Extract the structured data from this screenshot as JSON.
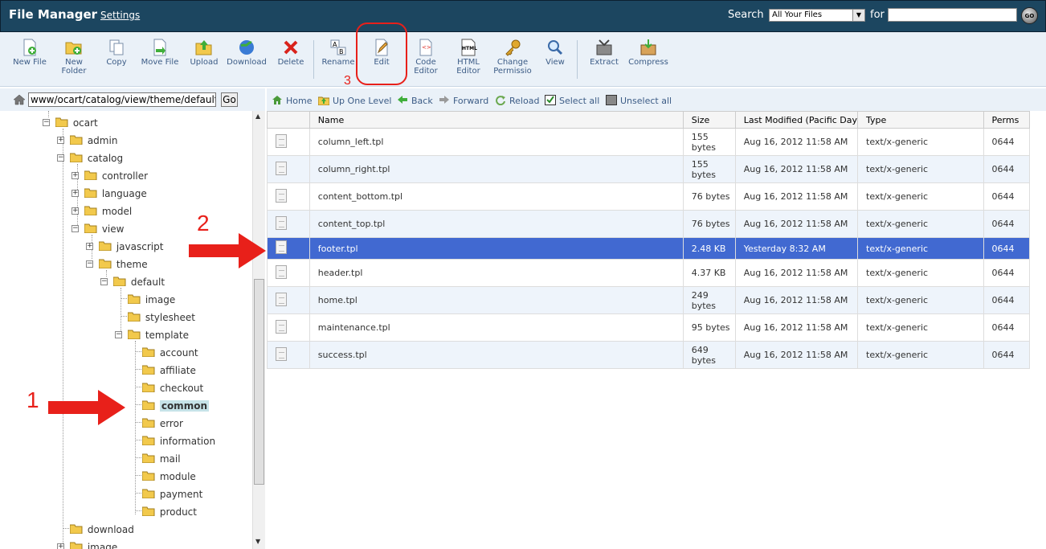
{
  "header": {
    "title": "File Manager",
    "settings_label": "Settings",
    "search_label": "Search",
    "search_scope": "All Your Files",
    "for_label": "for",
    "go_label": "GO"
  },
  "toolbar": {
    "new_file": "New File",
    "new_folder": "New Folder",
    "copy": "Copy",
    "move_file": "Move File",
    "upload": "Upload",
    "download": "Download",
    "delete": "Delete",
    "rename": "Rename",
    "edit": "Edit",
    "code_editor": "Code Editor",
    "html_editor": "HTML Editor",
    "change_permissions": "Change Permissio",
    "view": "View",
    "extract": "Extract",
    "compress": "Compress"
  },
  "address": {
    "path": "www/ocart/catalog/view/theme/default/t",
    "go_label": "Go"
  },
  "nav": {
    "home": "Home",
    "up_one_level": "Up One Level",
    "back": "Back",
    "forward": "Forward",
    "reload": "Reload",
    "select_all": "Select all",
    "unselect_all": "Unselect all"
  },
  "tree": {
    "ocart": "ocart",
    "admin": "admin",
    "catalog": "catalog",
    "controller": "controller",
    "language": "language",
    "model": "model",
    "view": "view",
    "javascript": "javascript",
    "theme": "theme",
    "default": "default",
    "image": "image",
    "stylesheet": "stylesheet",
    "template": "template",
    "account": "account",
    "affiliate": "affiliate",
    "checkout": "checkout",
    "common": "common",
    "error": "error",
    "information": "information",
    "mail": "mail",
    "module": "module",
    "payment": "payment",
    "product": "product",
    "download": "download",
    "image2": "image"
  },
  "table": {
    "columns": [
      "Name",
      "Size",
      "Last Modified (Pacific Day",
      "Type",
      "Perms"
    ],
    "rows": [
      {
        "name": "column_left.tpl",
        "size": "155 bytes",
        "modified": "Aug 16, 2012 11:58 AM",
        "type": "text/x-generic",
        "perms": "0644"
      },
      {
        "name": "column_right.tpl",
        "size": "155 bytes",
        "modified": "Aug 16, 2012 11:58 AM",
        "type": "text/x-generic",
        "perms": "0644"
      },
      {
        "name": "content_bottom.tpl",
        "size": "76 bytes",
        "modified": "Aug 16, 2012 11:58 AM",
        "type": "text/x-generic",
        "perms": "0644"
      },
      {
        "name": "content_top.tpl",
        "size": "76 bytes",
        "modified": "Aug 16, 2012 11:58 AM",
        "type": "text/x-generic",
        "perms": "0644"
      },
      {
        "name": "footer.tpl",
        "size": "2.48 KB",
        "modified": "Yesterday 8:32 AM",
        "type": "text/x-generic",
        "perms": "0644"
      },
      {
        "name": "header.tpl",
        "size": "4.37 KB",
        "modified": "Aug 16, 2012 11:58 AM",
        "type": "text/x-generic",
        "perms": "0644"
      },
      {
        "name": "home.tpl",
        "size": "249 bytes",
        "modified": "Aug 16, 2012 11:58 AM",
        "type": "text/x-generic",
        "perms": "0644"
      },
      {
        "name": "maintenance.tpl",
        "size": "95 bytes",
        "modified": "Aug 16, 2012 11:58 AM",
        "type": "text/x-generic",
        "perms": "0644"
      },
      {
        "name": "success.tpl",
        "size": "649 bytes",
        "modified": "Aug 16, 2012 11:58 AM",
        "type": "text/x-generic",
        "perms": "0644"
      }
    ]
  },
  "annotations": {
    "step1": "1",
    "step2": "2",
    "step3": "3"
  },
  "colors": {
    "header_bg": "#1c4660",
    "selected_row": "#4169d1",
    "annotation": "#e8201a"
  }
}
